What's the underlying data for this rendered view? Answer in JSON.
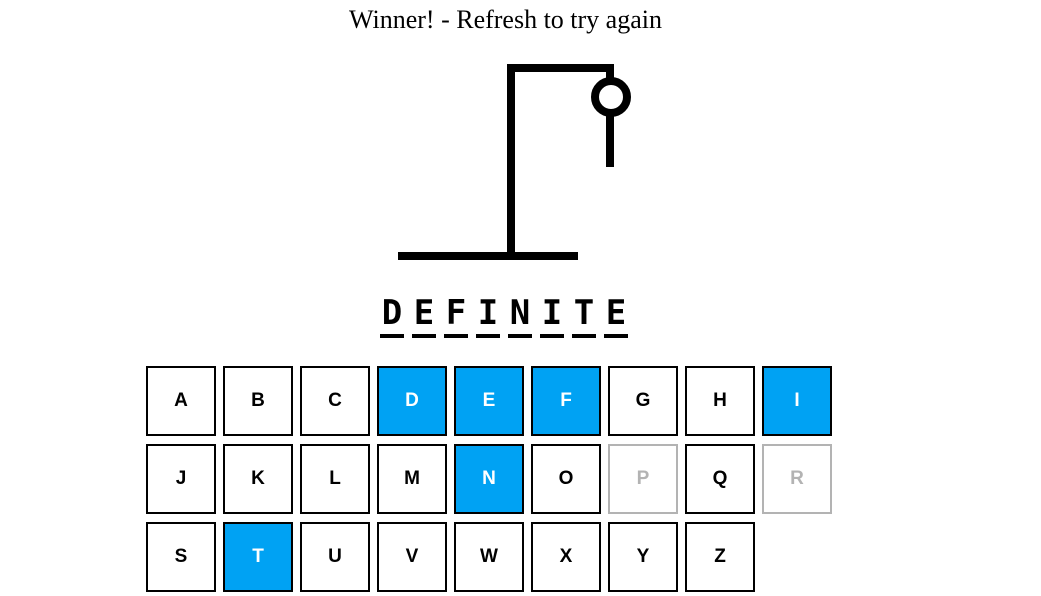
{
  "status_message": "Winner! - Refresh to try again",
  "hangman": {
    "wrong_guesses": 2,
    "parts_drawn": [
      "head",
      "body"
    ]
  },
  "word": [
    "D",
    "E",
    "F",
    "I",
    "N",
    "I",
    "T",
    "E"
  ],
  "keyboard": {
    "keys": [
      {
        "letter": "A",
        "state": "unused"
      },
      {
        "letter": "B",
        "state": "unused"
      },
      {
        "letter": "C",
        "state": "unused"
      },
      {
        "letter": "D",
        "state": "correct"
      },
      {
        "letter": "E",
        "state": "correct"
      },
      {
        "letter": "F",
        "state": "correct"
      },
      {
        "letter": "G",
        "state": "unused"
      },
      {
        "letter": "H",
        "state": "unused"
      },
      {
        "letter": "I",
        "state": "correct"
      },
      {
        "letter": "J",
        "state": "unused"
      },
      {
        "letter": "K",
        "state": "unused"
      },
      {
        "letter": "L",
        "state": "unused"
      },
      {
        "letter": "M",
        "state": "unused"
      },
      {
        "letter": "N",
        "state": "correct"
      },
      {
        "letter": "O",
        "state": "unused"
      },
      {
        "letter": "P",
        "state": "wrong"
      },
      {
        "letter": "Q",
        "state": "unused"
      },
      {
        "letter": "R",
        "state": "wrong"
      },
      {
        "letter": "S",
        "state": "unused"
      },
      {
        "letter": "T",
        "state": "correct"
      },
      {
        "letter": "U",
        "state": "unused"
      },
      {
        "letter": "V",
        "state": "unused"
      },
      {
        "letter": "W",
        "state": "unused"
      },
      {
        "letter": "X",
        "state": "unused"
      },
      {
        "letter": "Y",
        "state": "unused"
      },
      {
        "letter": "Z",
        "state": "unused"
      }
    ]
  },
  "colors": {
    "correct_bg": "#00a2f3",
    "wrong_border": "#b3b3b3",
    "ink": "#000000"
  }
}
